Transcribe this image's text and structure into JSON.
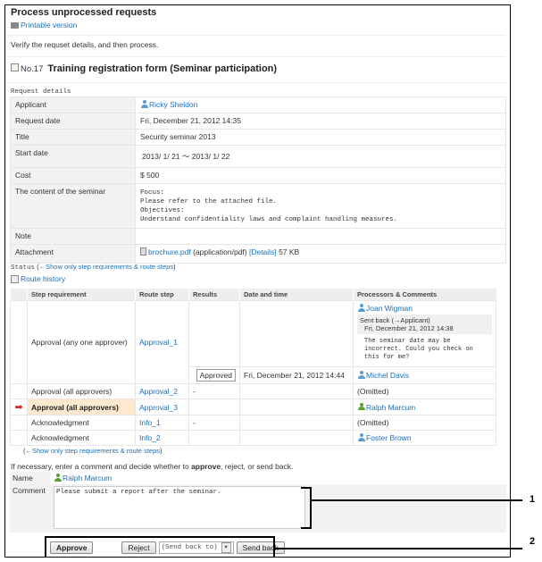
{
  "header": {
    "title": "Process unprocessed requests",
    "printable_label": "Printable version",
    "instruction": "Verify the requset details, and then process.",
    "form_number": "No.17",
    "form_name": "Training registration form (Seminar participation)"
  },
  "request_details": {
    "section_label": "Request details",
    "rows": [
      {
        "key": "Applicant",
        "value": "Ricky Sheldon"
      },
      {
        "key": "Request date",
        "value": "Fri, December 21, 2012 14:35"
      },
      {
        "key": "Title",
        "value": "Security seminar 2013"
      },
      {
        "key": "Start date",
        "value": "2013/ 1/ 21 〜 2013/ 1/ 22"
      },
      {
        "key": "Cost",
        "value": "$ 500"
      },
      {
        "key": "The content of the seminar",
        "value": "Focus:\nPlease refer to the attached file.\nObjectives:\nUnderstand confidentiality laws and complaint handling measures."
      },
      {
        "key": "Note",
        "value": ""
      },
      {
        "key": "Attachment",
        "file_name": "brochure.pdf",
        "file_type": "(application/pdf)",
        "details_link": "[Details]",
        "file_size": "57 KB"
      }
    ]
  },
  "status": {
    "section_label": "Status",
    "toggle_open": "(",
    "toggle_link": "←Show only step requirements & route steps",
    "toggle_close": ")",
    "route_history_label": "Route history",
    "columns": [
      "Step requirement",
      "Route step",
      "Results",
      "Date and time",
      "Processors & Comments"
    ],
    "rows": [
      {
        "step_requirement": "Approval (any one approver)",
        "route_step": "Approval_1",
        "processors": [
          {
            "name": "Joan Wigman",
            "result": "",
            "datetime": "",
            "sent_back_label": "Sent back (→Applicant)",
            "sent_back_datetime": "Fri, December 21, 2012 14:38",
            "comment": "The seminar date may be\nincorrect. Could you check on\nthis for me?"
          },
          {
            "name": "Michel Davis",
            "result": "Approved",
            "datetime": "Fri, December 21, 2012 14:44"
          }
        ]
      },
      {
        "step_requirement": "Approval (all approvers)",
        "route_step": "Approval_2",
        "result": "-",
        "datetime": "",
        "processor": "(Omitted)"
      },
      {
        "step_requirement": "Approval (all approvers)",
        "route_step": "Approval_3",
        "result": "",
        "datetime": "",
        "processor": "Ralph Marcum",
        "current": true
      },
      {
        "step_requirement": "Acknowledgment",
        "route_step": "Info_1",
        "result": "-",
        "datetime": "",
        "processor": "(Omitted)"
      },
      {
        "step_requirement": "Acknowledgment",
        "route_step": "Info_2",
        "result": "",
        "datetime": "",
        "processor": "Foster Brown"
      }
    ],
    "bottom_toggle_open": "(",
    "bottom_toggle_link": "←Show only step requirements & route steps",
    "bottom_toggle_close": ")"
  },
  "action_form": {
    "instruction_prefix": "If necessary, enter a comment and decide whether to ",
    "instruction_bold": "approve",
    "instruction_suffix": ", reject, or send back.",
    "name_label": "Name",
    "name_value": "Ralph Marcum",
    "comment_label": "Comment",
    "comment_value": "Please submit a report after the seminar.",
    "approve_label": "Approve",
    "reject_label": "Reject",
    "send_back_select": "(Send back to)",
    "send_back_label": "Send back"
  },
  "callouts": [
    "1",
    "2"
  ],
  "colors": {
    "link": "#1a6fc0",
    "current_step_bg": "#fde9cf",
    "current_arrow": "#e02020",
    "user_icon_blue": "#5b9bd5",
    "user_icon_green": "#5aa02c"
  }
}
